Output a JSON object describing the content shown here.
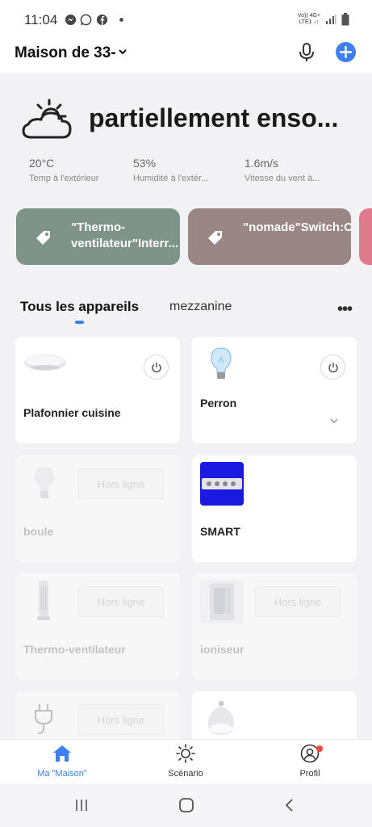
{
  "status_bar": {
    "time": "11:04",
    "network_line1": "Vo)) 4G+",
    "network_line2": "LTE1 ↓↑",
    "icons": [
      "messenger-icon",
      "whatsapp-icon",
      "facebook-icon",
      "dot-icon",
      "signal-icon",
      "battery-icon"
    ]
  },
  "header": {
    "home_name": "Maison de 33-",
    "icons": [
      "chevron-down-icon",
      "microphone-icon",
      "plus-icon"
    ],
    "accent": "#3d7ff0"
  },
  "weather": {
    "condition": "partiellement enso...",
    "icon": "partly-cloudy-icon",
    "stats": [
      {
        "value": "20°C",
        "label": "Temp à l'extérieur"
      },
      {
        "value": "53%",
        "label": "Humidité à l'extér..."
      },
      {
        "value": "1.6m/s",
        "label": "Vitesse du vent à..."
      }
    ]
  },
  "scenes": [
    {
      "text": "\"Thermo-ventilateur\"Interr...",
      "color": "#7e9488",
      "icon": "tag-icon"
    },
    {
      "text": "\"nomade\"Switch:ON...",
      "color": "#9a8685",
      "icon": "tag-icon"
    },
    {
      "text": "",
      "color": "#df7a8c",
      "icon": ""
    }
  ],
  "tabs": {
    "all": "Tous les appareils",
    "room": "mezzanine",
    "more_icon": "more-dots-icon"
  },
  "devices": [
    {
      "name": "Plafonnier cuisine",
      "status": "online",
      "icon": "ceiling-light-icon",
      "control": "power-icon"
    },
    {
      "name": "Perron",
      "status": "online",
      "icon": "bulb-icon",
      "control": "power-icon"
    },
    {
      "name": "boule",
      "status": "Hors ligne",
      "icon": "bulb-icon"
    },
    {
      "name": "SMART",
      "status": "online",
      "icon": "power-strip-icon"
    },
    {
      "name": "Thermo-ventilateur",
      "status": "Hors ligne",
      "icon": "tower-fan-icon"
    },
    {
      "name": "ioniseur",
      "status": "Hors ligne",
      "icon": "air-purifier-icon"
    },
    {
      "name": "",
      "status": "Hors ligne",
      "icon": "plug-icon"
    },
    {
      "name": "",
      "status": "online",
      "icon": "diffuser-icon"
    }
  ],
  "bottom_nav": [
    {
      "label": "Ma \"Maison\"",
      "icon": "home-icon",
      "active": true
    },
    {
      "label": "Scénario",
      "icon": "sun-icon",
      "active": false
    },
    {
      "label": "Profil",
      "icon": "profile-icon",
      "active": false,
      "badge": true
    }
  ],
  "system_nav": [
    "recent-apps-icon",
    "home-button-icon",
    "back-icon"
  ]
}
